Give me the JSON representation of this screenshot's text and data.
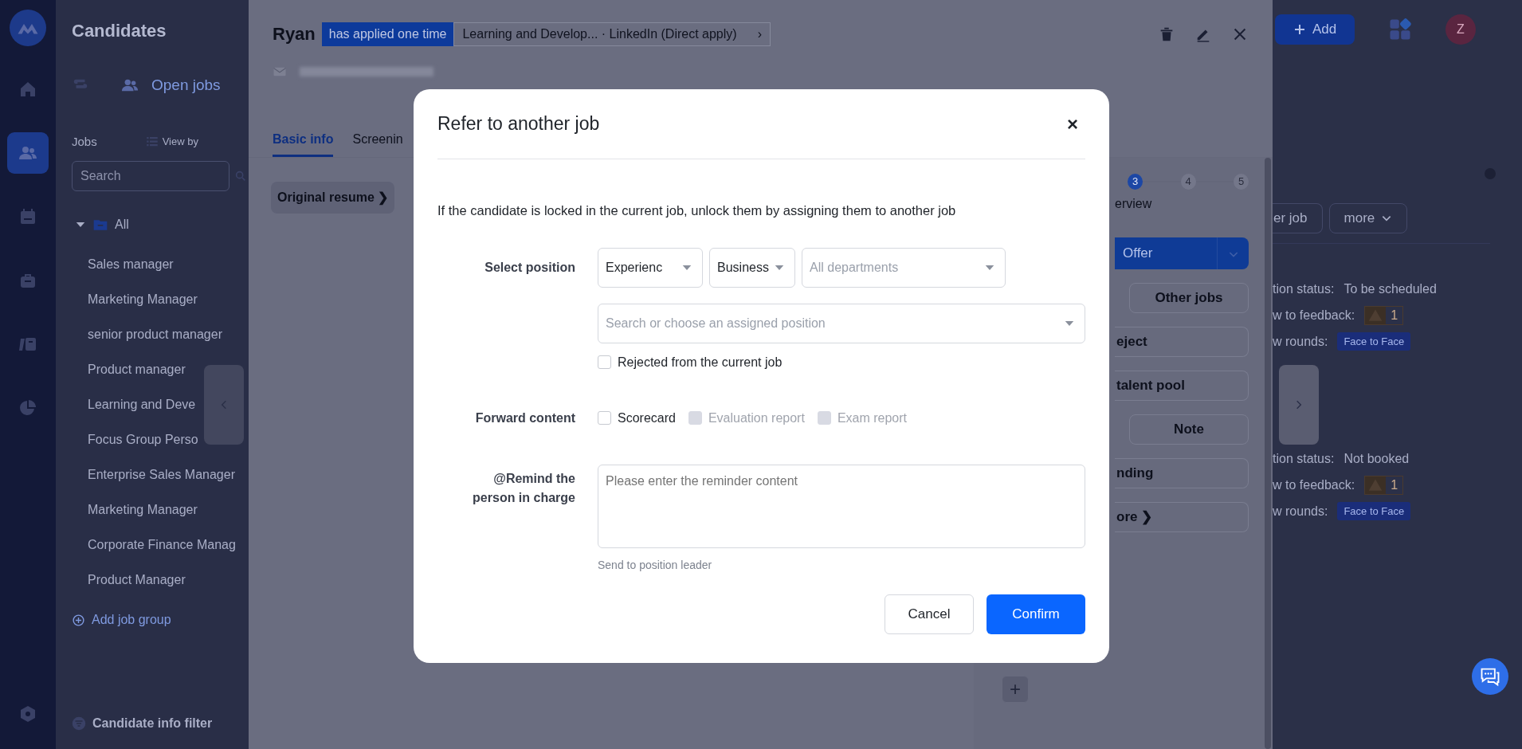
{
  "rail": {
    "items": [
      {
        "kind": "home",
        "selected": false
      },
      {
        "kind": "people",
        "selected": true
      },
      {
        "kind": "calendar",
        "selected": false
      },
      {
        "kind": "briefcase",
        "selected": false
      },
      {
        "kind": "book",
        "selected": false
      },
      {
        "kind": "pie",
        "selected": false
      }
    ],
    "bottom": {
      "kind": "settings"
    }
  },
  "sidebar": {
    "title": "Candidates",
    "tab": "Open jobs",
    "jobs_label": "Jobs",
    "view_by": "View by",
    "search": {
      "placeholder": "Search"
    },
    "tree": {
      "label": "All",
      "expanded": true,
      "children": [
        {
          "label": "Sales manager"
        },
        {
          "label": "Marketing Manager"
        },
        {
          "label": "senior product manager"
        },
        {
          "label": "Product manager"
        },
        {
          "label": "Learning and Deve"
        },
        {
          "label": "Focus Group Perso"
        },
        {
          "label": "Enterprise Sales Manager"
        },
        {
          "label": "Marketing Manager"
        },
        {
          "label": "Corporate Finance Manag"
        },
        {
          "label": "Product Manager"
        }
      ]
    },
    "add_group": "Add job group",
    "filter": "Candidate info filter"
  },
  "drawer": {
    "name": "Ryan",
    "applied_badge": "has applied one time",
    "application": "Learning and Develop... · LinkedIn  (Direct apply)",
    "chevron": "›",
    "tabs": [
      {
        "label": "Basic info",
        "selected": true
      },
      {
        "label": "Screenin",
        "selected": false
      }
    ],
    "resume_button": "Original resume ❯",
    "stage_label": "erview",
    "steps": [
      {
        "label": "3",
        "selected": true
      },
      {
        "label": "4",
        "selected": false
      },
      {
        "label": "5",
        "selected": false
      }
    ],
    "primary_action": "Offer",
    "actions": [
      {
        "label": "Other jobs",
        "kind": "whole"
      },
      {
        "label": "eject",
        "kind": "cut"
      },
      {
        "label": "talent pool",
        "kind": "cut"
      },
      {
        "label": "Note",
        "kind": "whole"
      },
      {
        "label": "nding",
        "kind": "cut"
      },
      {
        "label": "ore ❯",
        "kind": "cut"
      }
    ],
    "add_symbol": "+"
  },
  "background": {
    "add_button": "Add",
    "avatar": "Z",
    "actions": [
      {
        "label": "er job",
        "kind": "plain"
      },
      {
        "label": "more",
        "kind": "menu"
      }
    ],
    "interviews": [
      {
        "status_label": "tion status:",
        "status": "To be scheduled",
        "feedback_label": "w to feedback:",
        "feedback_count": "1",
        "rounds_label": "w rounds:",
        "round": "Face to Face"
      },
      {
        "status_label": "tion status:",
        "status": "Not booked",
        "feedback_label": "w to feedback:",
        "feedback_count": "1",
        "rounds_label": "w rounds:",
        "round": "Face to Face"
      }
    ]
  },
  "modal": {
    "title": "Refer to another job",
    "close": "×",
    "description": "If the candidate is locked in the current job, unlock them by assigning them to another job",
    "select_label": "Select position",
    "filters": [
      {
        "value": "Experienc"
      },
      {
        "value": "Business"
      },
      {
        "placeholder": "All departments"
      }
    ],
    "position": {
      "placeholder": "Search or choose an assigned position"
    },
    "rejected": {
      "label": "Rejected from the current job",
      "checked": false
    },
    "forward_label": "Forward content",
    "forward_options": [
      {
        "label": "Scorecard",
        "checked": false,
        "disabled": false
      },
      {
        "label": "Evaluation report",
        "checked": false,
        "disabled": true
      },
      {
        "label": "Exam report",
        "checked": false,
        "disabled": true
      }
    ],
    "remind_label": "@Remind the person in charge",
    "reminder": {
      "placeholder": "Please enter the reminder content"
    },
    "hint": "Send to position leader",
    "buttons": [
      {
        "label": "Cancel",
        "kind": "secondary"
      },
      {
        "label": "Confirm",
        "kind": "primary"
      }
    ]
  }
}
